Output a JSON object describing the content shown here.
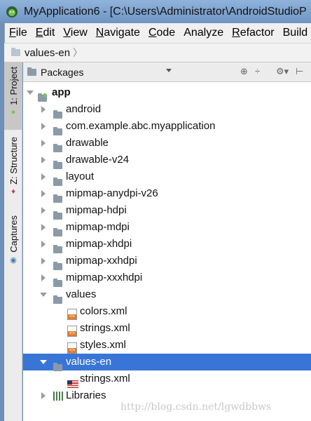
{
  "window": {
    "title": "MyApplication6 - [C:\\Users\\Administrator\\AndroidStudioP"
  },
  "menu": [
    {
      "mnemonic": "F",
      "rest": "ile"
    },
    {
      "mnemonic": "E",
      "rest": "dit"
    },
    {
      "mnemonic": "V",
      "rest": "iew"
    },
    {
      "mnemonic": "N",
      "rest": "avigate"
    },
    {
      "mnemonic": "C",
      "rest": "ode"
    },
    {
      "mnemonic": "",
      "rest": "Analyze"
    },
    {
      "mnemonic": "R",
      "rest": "efactor"
    },
    {
      "mnemonic": "",
      "rest": "Build"
    }
  ],
  "breadcrumb": {
    "label": "values-en",
    "separator": "〉"
  },
  "side_tabs": {
    "project": "1: Project",
    "structure": "Z: Structure",
    "captures": "Captures"
  },
  "panel": {
    "title": "Packages"
  },
  "tree": [
    {
      "label": "app",
      "bold": true,
      "arrow": "down",
      "icon": "module-icon"
    },
    {
      "label": "android",
      "arrow": "right",
      "icon": "folder-icon"
    },
    {
      "label": "com.example.abc.myapplication",
      "arrow": "right",
      "icon": "folder-icon"
    },
    {
      "label": "drawable",
      "arrow": "right",
      "icon": "folder-icon"
    },
    {
      "label": "drawable-v24",
      "arrow": "right",
      "icon": "folder-icon"
    },
    {
      "label": "layout",
      "arrow": "right",
      "icon": "folder-icon"
    },
    {
      "label": "mipmap-anydpi-v26",
      "arrow": "right",
      "icon": "folder-icon"
    },
    {
      "label": "mipmap-hdpi",
      "arrow": "right",
      "icon": "folder-icon"
    },
    {
      "label": "mipmap-mdpi",
      "arrow": "right",
      "icon": "folder-icon"
    },
    {
      "label": "mipmap-xhdpi",
      "arrow": "right",
      "icon": "folder-icon"
    },
    {
      "label": "mipmap-xxhdpi",
      "arrow": "right",
      "icon": "folder-icon"
    },
    {
      "label": "mipmap-xxxhdpi",
      "arrow": "right",
      "icon": "folder-icon"
    },
    {
      "label": "values",
      "arrow": "down",
      "icon": "folder-icon"
    },
    {
      "label": "colors.xml",
      "arrow": "",
      "icon": "xml-file-icon"
    },
    {
      "label": "strings.xml",
      "arrow": "",
      "icon": "xml-file-icon"
    },
    {
      "label": "styles.xml",
      "arrow": "",
      "icon": "xml-file-icon"
    },
    {
      "label": "values-en",
      "arrow": "down",
      "icon": "folder-icon",
      "selected": true
    },
    {
      "label": "strings.xml",
      "arrow": "",
      "icon": "us-flag-icon"
    },
    {
      "label": "Libraries",
      "arrow": "right",
      "icon": "libraries-icon"
    }
  ],
  "watermark": "http://blog.csdn.net/lgwdbbws",
  "colors": {
    "selection": "#3875d7",
    "titlebar": "#7fa3cf",
    "android_green": "#78c257"
  }
}
